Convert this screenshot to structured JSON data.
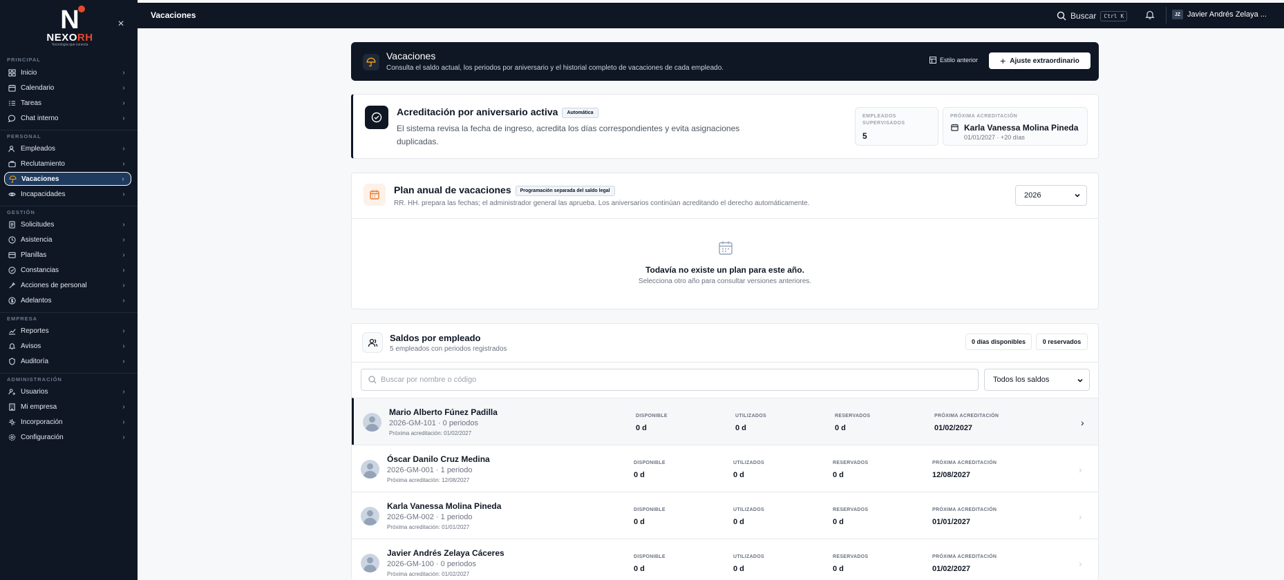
{
  "sidebar": {
    "logo": {
      "letter": "N",
      "word_a": "NEXO",
      "word_b": "RH",
      "tagline": "Tecnología que conecta"
    },
    "sections": [
      {
        "label": "PRINCIPAL",
        "items": [
          {
            "label": "Inicio",
            "icon": "dashboard-icon"
          },
          {
            "label": "Calendario",
            "icon": "calendar-icon"
          },
          {
            "label": "Tareas",
            "icon": "tasks-icon"
          },
          {
            "label": "Chat interno",
            "icon": "chat-icon"
          }
        ]
      },
      {
        "label": "PERSONAL",
        "items": [
          {
            "label": "Empleados",
            "icon": "users-icon"
          },
          {
            "label": "Reclutamiento",
            "icon": "briefcase-icon"
          },
          {
            "label": "Vacaciones",
            "icon": "umbrella-icon",
            "active": true
          },
          {
            "label": "Incapacidades",
            "icon": "health-icon"
          }
        ]
      },
      {
        "label": "GESTIÓN",
        "items": [
          {
            "label": "Solicitudes",
            "icon": "document-icon"
          },
          {
            "label": "Asistencia",
            "icon": "clock-icon"
          },
          {
            "label": "Planillas",
            "icon": "payroll-icon"
          },
          {
            "label": "Constancias",
            "icon": "certificate-icon"
          },
          {
            "label": "Acciones de personal",
            "icon": "action-icon"
          },
          {
            "label": "Adelantos",
            "icon": "money-icon"
          }
        ]
      },
      {
        "label": "EMPRESA",
        "items": [
          {
            "label": "Reportes",
            "icon": "chart-icon"
          },
          {
            "label": "Avisos",
            "icon": "bell-icon"
          },
          {
            "label": "Auditoría",
            "icon": "audit-icon"
          }
        ]
      },
      {
        "label": "ADMINISTRACIÓN",
        "items": [
          {
            "label": "Usuarios",
            "icon": "user-key-icon"
          },
          {
            "label": "Mi empresa",
            "icon": "building-icon"
          },
          {
            "label": "Incorporación",
            "icon": "onboarding-icon"
          },
          {
            "label": "Configuración",
            "icon": "gear-icon"
          }
        ]
      }
    ]
  },
  "topbar": {
    "title": "Vacaciones",
    "search_label": "Buscar",
    "search_shortcut": "Ctrl K",
    "user_initials": "JZ",
    "user_name": "Javier Andrés Zelaya ..."
  },
  "hero": {
    "title": "Vacaciones",
    "subtitle": "Consulta el saldo actual, los periodos por aniversario y el historial completo de vacaciones de cada empleado.",
    "old_style_label": "Estilo anterior",
    "adjust_label": "Ajuste extraordinario"
  },
  "accreditation": {
    "title": "Acreditación por aniversario activa",
    "badge": "Automática",
    "description": "El sistema revisa la fecha de ingreso, acredita los días correspondientes y evita asignaciones duplicadas.",
    "supervised_label_1": "EMPLEADOS",
    "supervised_label_2": "SUPERVISADOS",
    "supervised_value": "5",
    "next_label": "PRÓXIMA ACREDITACIÓN",
    "next_name": "Karla Vanessa Molina Pineda",
    "next_detail": "01/01/2027 · +20 días"
  },
  "plan": {
    "title": "Plan anual de vacaciones",
    "badge": "Programación separada del saldo legal",
    "subtitle": "RR. HH. prepara las fechas; el administrador general las aprueba. Los aniversarios continúan acreditando el derecho automáticamente.",
    "year": "2026",
    "empty_title": "Todavía no existe un plan para este año.",
    "empty_subtitle": "Selecciona otro año para consultar versiones anteriores."
  },
  "balances": {
    "title": "Saldos por empleado",
    "subtitle": "5 empleados con periodos registrados",
    "available_pill": "0 días disponibles",
    "reserved_pill": "0 reservados",
    "search_placeholder": "Buscar por nombre o código",
    "filter": "Todos los saldos",
    "col_available": "DISPONIBLE",
    "col_used": "UTILIZADOS",
    "col_reserved": "RESERVADOS",
    "col_next": "PRÓXIMA ACREDITACIÓN",
    "rows": [
      {
        "name": "Mario Alberto Fúnez Padilla",
        "code": "2026-GM-101 · 0 periodos",
        "next_line": "Próxima acreditación: 01/02/2027",
        "available": "0 d",
        "used": "0 d",
        "reserved": "0 d",
        "next": "01/02/2027"
      },
      {
        "name": "Óscar Danilo Cruz Medina",
        "code": "2026-GM-001 · 1 periodo",
        "next_line": "Próxima acreditación: 12/08/2027",
        "available": "0 d",
        "used": "0 d",
        "reserved": "0 d",
        "next": "12/08/2027"
      },
      {
        "name": "Karla Vanessa Molina Pineda",
        "code": "2026-GM-002 · 1 periodo",
        "next_line": "Próxima acreditación: 01/01/2027",
        "available": "0 d",
        "used": "0 d",
        "reserved": "0 d",
        "next": "01/01/2027"
      },
      {
        "name": "Javier Andrés Zelaya Cáceres",
        "code": "2026-GM-100 · 0 periodos",
        "next_line": "Próxima acreditación: 01/02/2027",
        "available": "0 d",
        "used": "0 d",
        "reserved": "0 d",
        "next": "01/02/2027"
      }
    ]
  }
}
